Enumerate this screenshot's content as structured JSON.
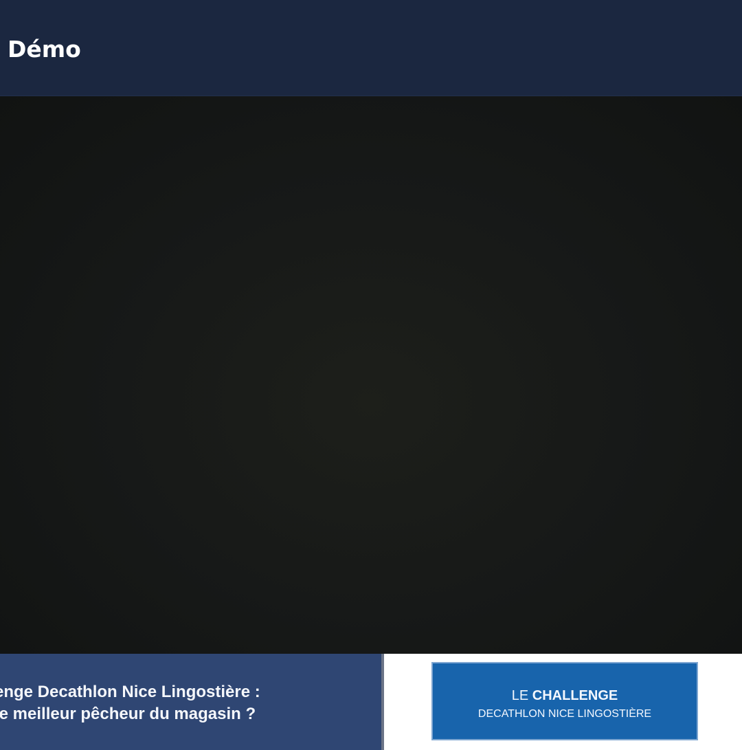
{
  "header": {
    "title": "Démo",
    "background_color": "#1b2740"
  },
  "main_media": {
    "background_color": "#171918"
  },
  "banner": {
    "left_lines": [
      "enge Decathlon Nice Lingostière :",
      "le meilleur pêcheur du magasin ?"
    ],
    "left_background_color": "#2f4673",
    "challenge_prefix": "LE",
    "challenge_title": "CHALLENGE",
    "challenge_subtitle": "DECATHLON NICE LINGOSTIÈRE",
    "challenge_background_color": "#1864ac"
  }
}
